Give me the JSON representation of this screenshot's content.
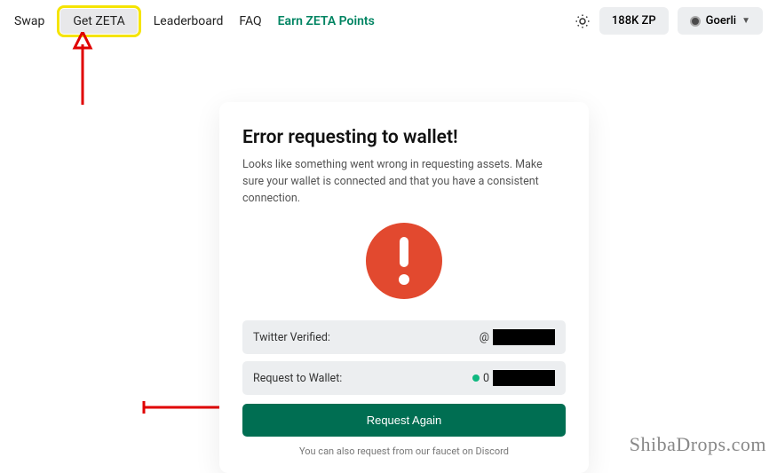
{
  "nav": {
    "swap": "Swap",
    "get_zeta": "Get ZETA",
    "leaderboard": "Leaderboard",
    "faq": "FAQ",
    "earn": "Earn ZETA Points",
    "points": "188K ZP",
    "network": "Goerli"
  },
  "card": {
    "title": "Error requesting to wallet!",
    "desc": "Looks like something went wrong in requesting assets. Make sure your wallet is connected and that you have a consistent connection.",
    "twitter_label": "Twitter Verified:",
    "twitter_value": "@",
    "wallet_label": "Request to Wallet:",
    "wallet_value": "0",
    "button": "Request Again",
    "footnote": "You can also request from our faucet on Discord"
  },
  "watermark": "ShibaDrops.com"
}
